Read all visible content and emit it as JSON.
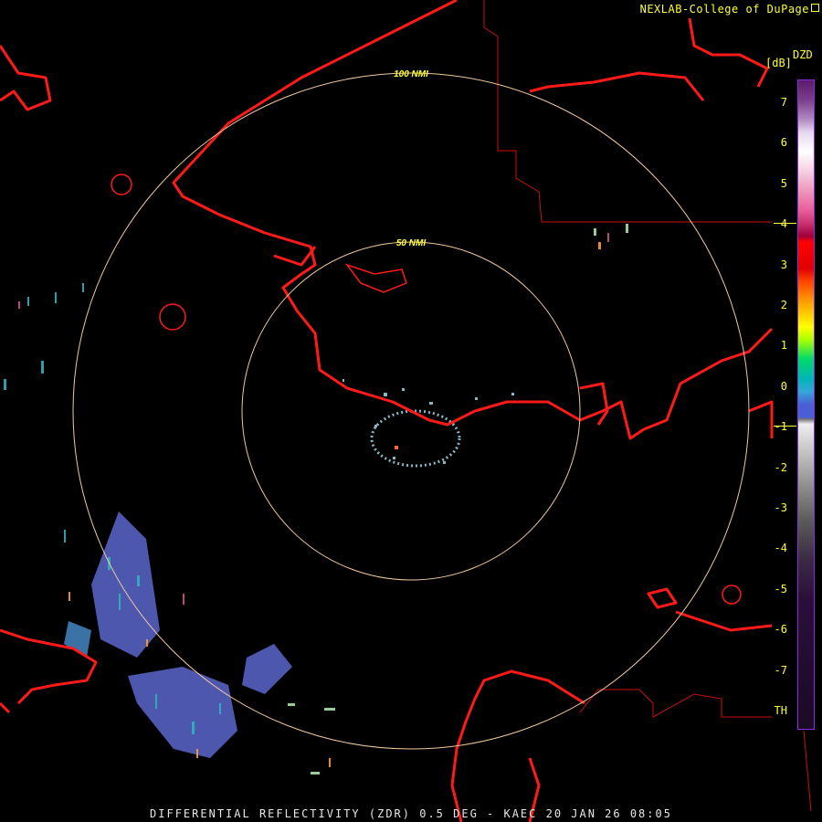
{
  "header": {
    "credit": "NEXLAB-College of DuPage",
    "logo_icon": "corner-logo-icon"
  },
  "footer": {
    "title": "DIFFERENTIAL REFLECTIVITY (ZDR) 0.5 DEG - KAEC 20 JAN 26 08:05"
  },
  "map": {
    "range_rings": [
      {
        "label": "100 NMI"
      },
      {
        "label": "50 NMI"
      }
    ],
    "colors": {
      "coastline": "#ff1a1a",
      "border": "#cc1111",
      "ring": "#f0c8a0",
      "label": "#ffff33"
    }
  },
  "colorbar": {
    "product": "DZD",
    "unit": "[dB]",
    "ticks": [
      "7",
      "6",
      "5",
      "4",
      "3",
      "2",
      "1",
      "0",
      "-1",
      "-2",
      "-3",
      "-4",
      "-5",
      "-6",
      "-7",
      "TH"
    ]
  }
}
